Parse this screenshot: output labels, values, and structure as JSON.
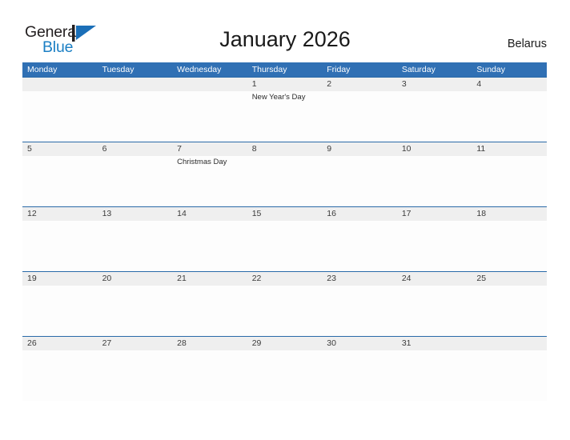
{
  "brand": {
    "name_part1": "General",
    "name_part2": "Blue",
    "flag_icon": "blue-flag-triangle-icon",
    "accent_blue": "#1b7fc4"
  },
  "header": {
    "title": "January 2026",
    "country": "Belarus"
  },
  "theme": {
    "header_blue": "#3070b4",
    "separator_blue": "#2a6aa8",
    "band_gray": "#efefef",
    "cell_white": "#fdfdfd"
  },
  "calendar": {
    "month": "January",
    "year": "2026",
    "weekday_headers": [
      "Monday",
      "Tuesday",
      "Wednesday",
      "Thursday",
      "Friday",
      "Saturday",
      "Sunday"
    ],
    "weeks": [
      [
        {
          "day": "",
          "event": ""
        },
        {
          "day": "",
          "event": ""
        },
        {
          "day": "",
          "event": ""
        },
        {
          "day": "1",
          "event": "New Year's Day"
        },
        {
          "day": "2",
          "event": ""
        },
        {
          "day": "3",
          "event": ""
        },
        {
          "day": "4",
          "event": ""
        }
      ],
      [
        {
          "day": "5",
          "event": ""
        },
        {
          "day": "6",
          "event": ""
        },
        {
          "day": "7",
          "event": "Christmas Day"
        },
        {
          "day": "8",
          "event": ""
        },
        {
          "day": "9",
          "event": ""
        },
        {
          "day": "10",
          "event": ""
        },
        {
          "day": "11",
          "event": ""
        }
      ],
      [
        {
          "day": "12",
          "event": ""
        },
        {
          "day": "13",
          "event": ""
        },
        {
          "day": "14",
          "event": ""
        },
        {
          "day": "15",
          "event": ""
        },
        {
          "day": "16",
          "event": ""
        },
        {
          "day": "17",
          "event": ""
        },
        {
          "day": "18",
          "event": ""
        }
      ],
      [
        {
          "day": "19",
          "event": ""
        },
        {
          "day": "20",
          "event": ""
        },
        {
          "day": "21",
          "event": ""
        },
        {
          "day": "22",
          "event": ""
        },
        {
          "day": "23",
          "event": ""
        },
        {
          "day": "24",
          "event": ""
        },
        {
          "day": "25",
          "event": ""
        }
      ],
      [
        {
          "day": "26",
          "event": ""
        },
        {
          "day": "27",
          "event": ""
        },
        {
          "day": "28",
          "event": ""
        },
        {
          "day": "29",
          "event": ""
        },
        {
          "day": "30",
          "event": ""
        },
        {
          "day": "31",
          "event": ""
        },
        {
          "day": "",
          "event": ""
        }
      ]
    ]
  }
}
